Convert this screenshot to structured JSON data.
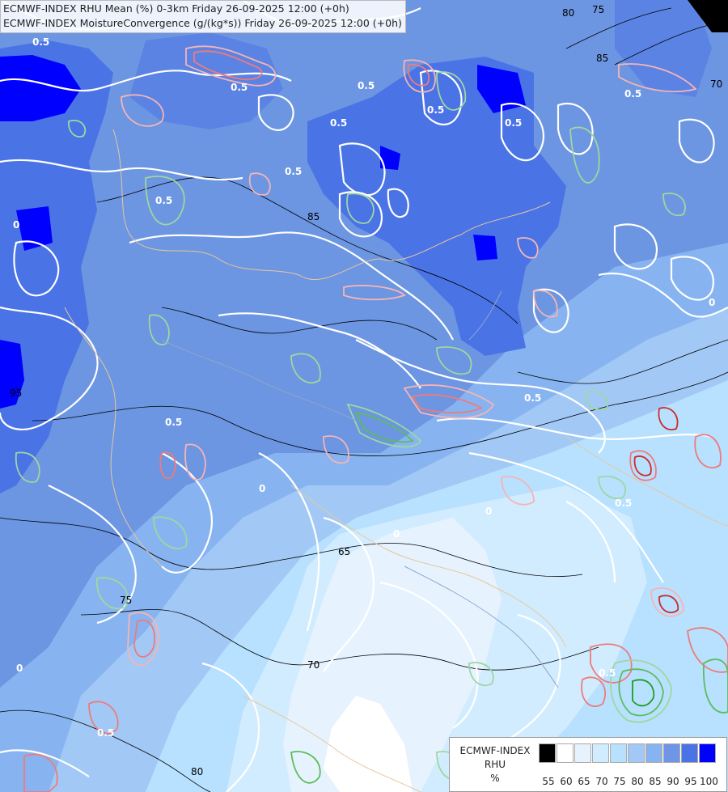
{
  "titles": {
    "line1": "ECMWF-INDEX RHU Mean (%) 0-3km Friday 26-09-2025 12:00 (+0h)",
    "line2": "ECMWF-INDEX MoistureConvergence (g/(kg*s)) Friday 26-09-2025 12:00 (+0h)"
  },
  "legend": {
    "label_lines": [
      "ECMWF-INDEX",
      "RHU",
      "%"
    ],
    "ticks": [
      "55",
      "60",
      "65",
      "70",
      "75",
      "80",
      "85",
      "90",
      "95",
      "100"
    ],
    "colors": [
      "#000000",
      "#ffffff",
      "#e6f3ff",
      "#d2ecff",
      "#b7e1ff",
      "#a2c9f5",
      "#87b4f0",
      "#6f96e6",
      "#4a73e6",
      "#0000ff"
    ]
  },
  "contour_labels": [
    "80",
    "75",
    "85",
    "70",
    "0.5",
    "0.5",
    "0.5",
    "0.5",
    "0.5",
    "0.5",
    "0.5",
    "0.5",
    "0.5",
    "0.5",
    "0",
    "0",
    "0",
    "0",
    "0",
    "0",
    "95",
    "85",
    "65",
    "75",
    "70",
    "80",
    "0.5",
    "0.5",
    "0.5",
    "0.5"
  ]
}
